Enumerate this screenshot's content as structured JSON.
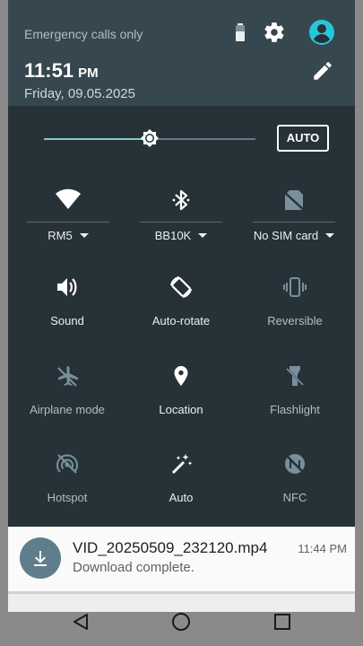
{
  "status": {
    "carrier_text": "Emergency calls only"
  },
  "header": {
    "time": "11:51",
    "ampm": "PM",
    "date": "Friday, 09.05.2025",
    "icons": [
      "battery-icon",
      "gear-icon",
      "account-icon",
      "edit-icon"
    ]
  },
  "brightness": {
    "level": 0.5,
    "auto_label": "AUTO"
  },
  "dropdown_tiles": [
    {
      "label": "RM5",
      "icon": "wifi-icon"
    },
    {
      "label": "BB10K",
      "icon": "bluetooth-icon"
    },
    {
      "label": "No SIM card",
      "icon": "no-sim-icon"
    }
  ],
  "tiles": [
    {
      "label": "Sound",
      "icon": "volume-icon",
      "active": true
    },
    {
      "label": "Auto-rotate",
      "icon": "rotate-icon",
      "active": true
    },
    {
      "label": "Reversible",
      "icon": "vibrate-icon",
      "active": false
    },
    {
      "label": "Airplane mode",
      "icon": "airplane-off-icon",
      "active": false
    },
    {
      "label": "Location",
      "icon": "location-icon",
      "active": true
    },
    {
      "label": "Flashlight",
      "icon": "flashlight-off-icon",
      "active": false
    },
    {
      "label": "Hotspot",
      "icon": "hotspot-off-icon",
      "active": false
    },
    {
      "label": "Auto",
      "icon": "magic-wand-icon",
      "active": true
    },
    {
      "label": "NFC",
      "icon": "nfc-off-icon",
      "active": false
    }
  ],
  "notification": {
    "title": "VID_20250509_232120.mp4",
    "subtitle": "Download complete.",
    "time": "11:44 PM",
    "icon": "download-icon"
  },
  "navbar": {
    "buttons": [
      "back-icon",
      "home-icon",
      "recents-icon"
    ]
  },
  "colors": {
    "panel": "#263238",
    "header": "#37474f",
    "accent": "#80cbc4"
  }
}
